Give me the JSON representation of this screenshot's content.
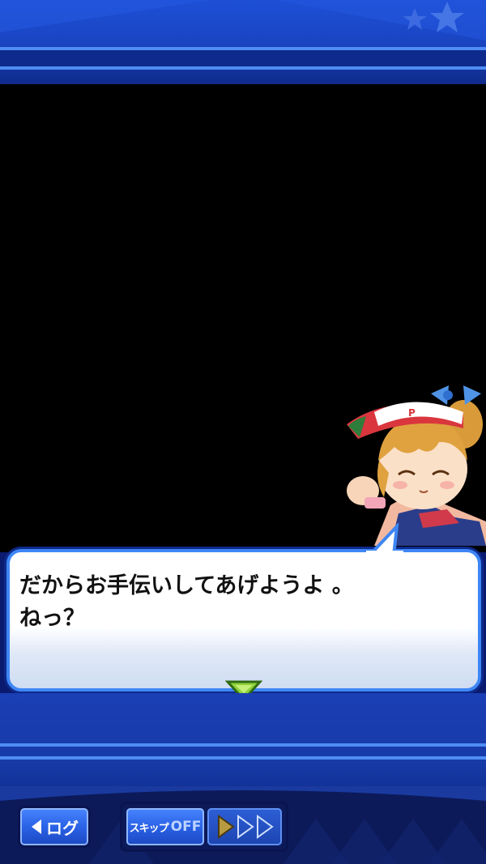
{
  "dialog": {
    "text": "だからお手伝いしてあげようよ 。\nねっ？"
  },
  "controls": {
    "log_label": "ログ",
    "skip_label": "スキップ",
    "skip_state": "OFF",
    "speed_level": 1,
    "speed_max": 3
  },
  "icons": {
    "back": "back-triangle-icon",
    "next": "next-page-arrow-icon",
    "speed": "fast-forward-icon",
    "decor": "star-icon"
  },
  "colors": {
    "accent": "#3e86f5",
    "frame_dark": "#0d2a8c",
    "next_arrow": "#8fd13a",
    "speed_active": "#b89a40"
  }
}
